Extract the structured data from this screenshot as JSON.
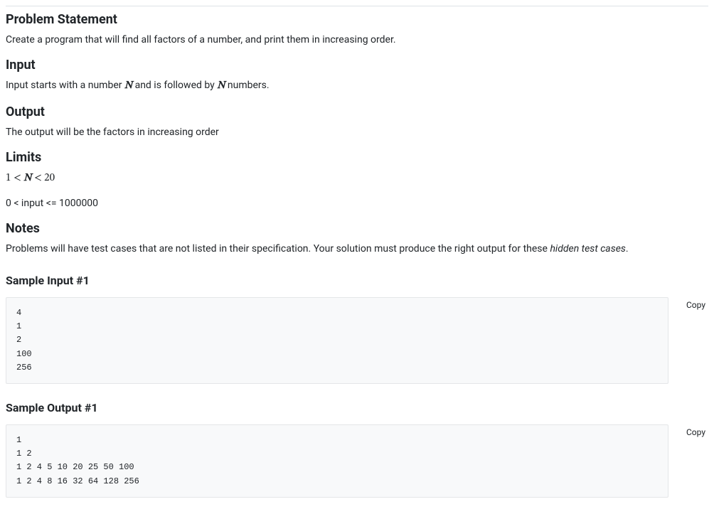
{
  "sections": {
    "problem_statement": {
      "heading": "Problem Statement",
      "text": "Create a program that will find all factors of a number, and print them in increasing order."
    },
    "input": {
      "heading": "Input",
      "prefix": "Input starts with a number ",
      "var1": "N",
      "middle": " and is followed by ",
      "var2": "N",
      "suffix": " numbers."
    },
    "output": {
      "heading": "Output",
      "text": "The output will be the factors in increasing order"
    },
    "limits": {
      "heading": "Limits",
      "line1_lhs": "1",
      "line1_op1": "<",
      "line1_var": "N",
      "line1_op2": "<",
      "line1_rhs": "20",
      "line2": "0 < input <= 1000000"
    },
    "notes": {
      "heading": "Notes",
      "prefix": "Problems will have test cases that are not listed in their specification. Your solution must produce the right output for these ",
      "emphasis": "hidden test cases",
      "suffix": "."
    }
  },
  "samples": {
    "input": {
      "heading": "Sample Input #1",
      "content": "4\n1\n2\n100\n256",
      "copy_label": "Copy"
    },
    "output": {
      "heading": "Sample Output #1",
      "content": "1\n1 2\n1 2 4 5 10 20 25 50 100\n1 2 4 8 16 32 64 128 256",
      "copy_label": "Copy"
    }
  }
}
